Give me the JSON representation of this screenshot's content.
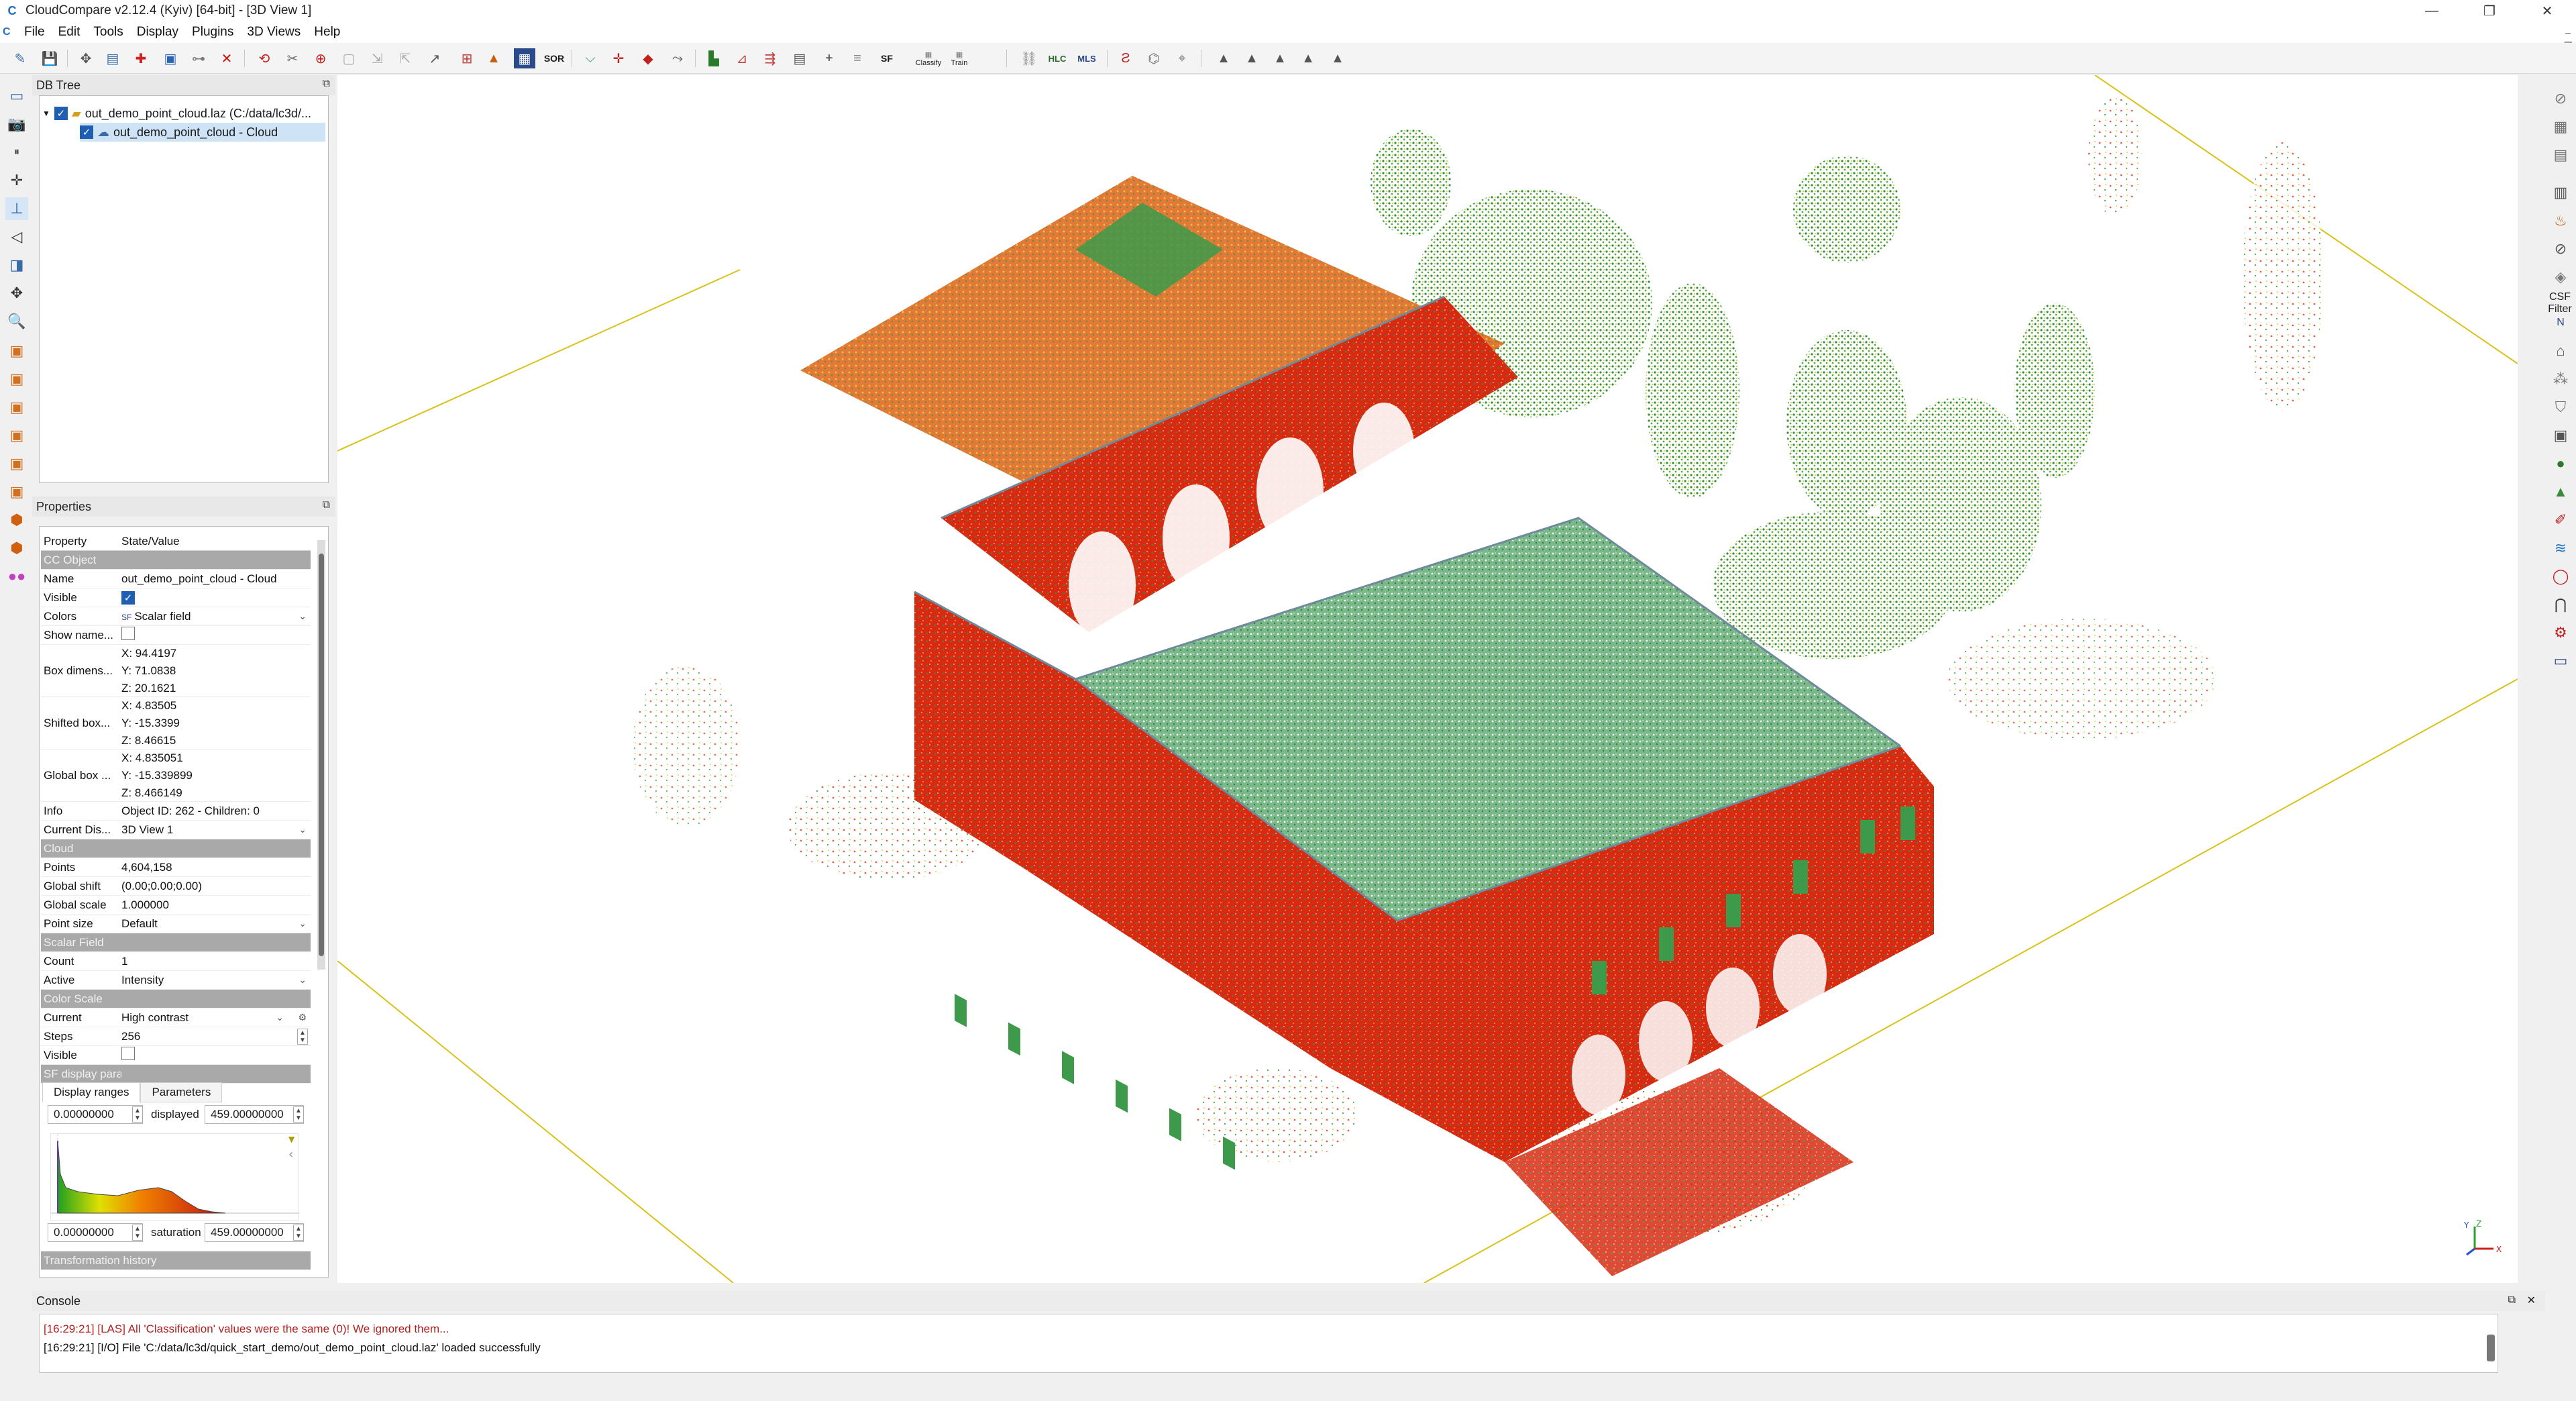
{
  "window": {
    "title": "CloudCompare v2.12.4 (Kyiv) [64-bit] - [3D View 1]",
    "controls": [
      "—",
      "❐",
      "✕"
    ]
  },
  "menu": [
    "File",
    "Edit",
    "Tools",
    "Display",
    "Plugins",
    "3D Views",
    "Help"
  ],
  "toolbar": {
    "sor_label": "SOR",
    "sf_label": "SF",
    "canupo_classify": "Classify",
    "canupo_train": "Train",
    "mls_label": "MLS",
    "hlc_label": "HLC"
  },
  "db_tree": {
    "title": "DB Tree",
    "items": [
      {
        "label": "out_demo_point_cloud.laz (C:/data/lc3d/..."
      },
      {
        "label": "out_demo_point_cloud - Cloud"
      }
    ]
  },
  "properties": {
    "title": "Properties",
    "header": {
      "key": "Property",
      "value": "State/Value"
    },
    "sections": {
      "cc_object": "CC Object",
      "cloud": "Cloud",
      "scalar_field": "Scalar Field",
      "color_scale": "Color Scale",
      "sf_display": "SF display params",
      "transformation": "Transformation history"
    },
    "rows": {
      "name": {
        "key": "Name",
        "value": "out_demo_point_cloud - Cloud"
      },
      "visible": {
        "key": "Visible"
      },
      "colors": {
        "key": "Colors",
        "value": "Scalar field"
      },
      "show_name": {
        "key": "Show name..."
      },
      "box_dims": {
        "key": "Box dimens...",
        "x": "X: 94.4197",
        "y": "Y: 71.0838",
        "z": "Z: 20.1621"
      },
      "shifted_box": {
        "key": "Shifted box...",
        "x": "X: 4.83505",
        "y": "Y: -15.3399",
        "z": "Z: 8.46615"
      },
      "global_box": {
        "key": "Global box ...",
        "x": "X: 4.835051",
        "y": "Y: -15.339899",
        "z": "Z: 8.466149"
      },
      "info": {
        "key": "Info",
        "value": "Object ID: 262 - Children: 0"
      },
      "current_display": {
        "key": "Current Dis...",
        "value": "3D View 1"
      },
      "points": {
        "key": "Points",
        "value": "4,604,158"
      },
      "global_shift": {
        "key": "Global shift",
        "value": "(0.00;0.00;0.00)"
      },
      "global_scale": {
        "key": "Global scale",
        "value": "1.000000"
      },
      "point_size": {
        "key": "Point size",
        "value": "Default"
      },
      "count": {
        "key": "Count",
        "value": "1"
      },
      "active": {
        "key": "Active",
        "value": "Intensity"
      },
      "current": {
        "key": "Current",
        "value": "High contrast"
      },
      "steps": {
        "key": "Steps",
        "value": "256"
      },
      "cs_visible": {
        "key": "Visible"
      }
    },
    "sf_tabs": [
      "Display ranges",
      "Parameters"
    ],
    "display_min": "0.00000000",
    "display_label": "displayed",
    "display_max": "459.00000000",
    "sat_min": "0.00000000",
    "sat_label": "saturation",
    "sat_max": "459.00000000"
  },
  "right_toolbar": {
    "csf_label": "CSF Filter"
  },
  "console": {
    "title": "Console",
    "lines": [
      {
        "text": "[16:29:21] [LAS] All 'Classification' values were the same (0)! We ignored them...",
        "color": "#b22222"
      },
      {
        "text": "[16:29:21] [I/O] File 'C:/data/lc3d/quick_start_demo/out_demo_point_cloud.laz' loaded successfully",
        "color": "#111111"
      }
    ]
  },
  "colors": {
    "accent": "#1e5fb4",
    "wall_red": "#d12a10",
    "roof_green": "#3c9a4a",
    "tree_green": "#2f8f3a",
    "yellow": "#d9c21a"
  }
}
